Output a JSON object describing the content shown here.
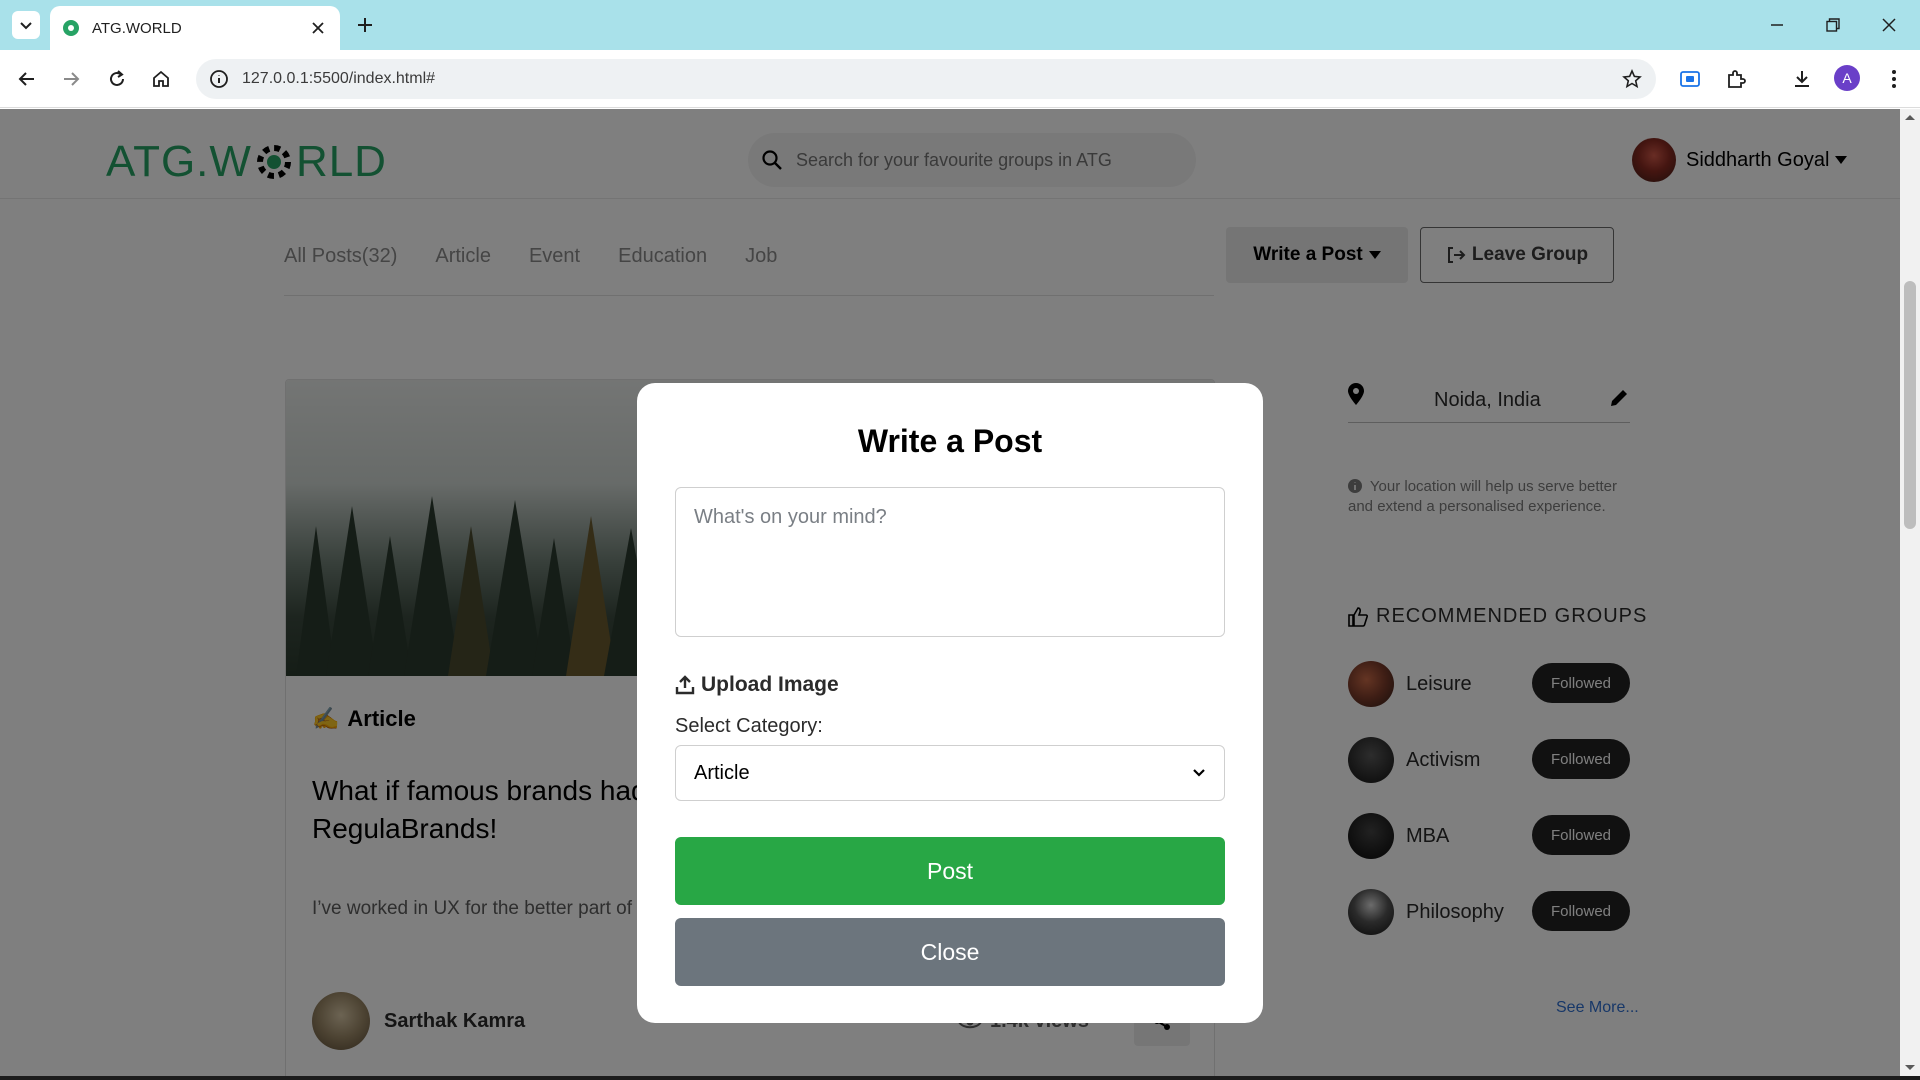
{
  "browser": {
    "tab_title": "ATG.WORLD",
    "url": "127.0.0.1:5500/index.html#",
    "profile_initial": "A"
  },
  "header": {
    "logo_left": "ATG.W",
    "logo_right": "RLD",
    "search_placeholder": "Search for your favourite groups in ATG",
    "user_name": "Siddharth Goyal"
  },
  "filters": [
    "All Posts(32)",
    "Article",
    "Event",
    "Education",
    "Job"
  ],
  "actions": {
    "write_post": "Write a Post",
    "leave_group": "Leave Group"
  },
  "post": {
    "category_emoji": "✍️",
    "category": "Article",
    "title_line1": "What if famous brands had",
    "title_line2": "RegulaBrands!",
    "excerpt": "I’ve worked in UX for the better part of a decade. From now on, I plan to rei...",
    "author": "Sarthak Kamra",
    "views": "1.4k views"
  },
  "sidebar": {
    "location": "Noida, India",
    "location_note": "Your location will help us serve better and extend a personalised experience.",
    "recommended_title": "RECOMMENDED GROUPS",
    "groups": [
      {
        "name": "Leisure",
        "button": "Followed"
      },
      {
        "name": "Activism",
        "button": "Followed"
      },
      {
        "name": "MBA",
        "button": "Followed"
      },
      {
        "name": "Philosophy",
        "button": "Followed"
      }
    ],
    "see_more": "See More..."
  },
  "modal": {
    "title": "Write a Post",
    "textarea_placeholder": "What's on your mind?",
    "upload_label": "Upload Image",
    "category_label": "Select Category:",
    "category_value": "Article",
    "post_button": "Post",
    "close_button": "Close"
  },
  "colors": {
    "brand_green": "#27a365",
    "post_button": "#28a745",
    "close_button": "#6c757d",
    "tab_strip": "#a9e1ea"
  },
  "icons": [
    "chevron-down-icon",
    "close-icon",
    "plus-icon",
    "minimize-icon",
    "restore-icon",
    "back-icon",
    "forward-icon",
    "reload-icon",
    "home-icon",
    "info-icon",
    "star-icon",
    "cast-icon",
    "extensions-icon",
    "download-icon",
    "menu-icon",
    "search-icon",
    "caret-down-icon",
    "sign-out-icon",
    "pin-icon",
    "pencil-icon",
    "thumbs-up-icon",
    "eye-icon",
    "share-icon",
    "upload-icon"
  ]
}
